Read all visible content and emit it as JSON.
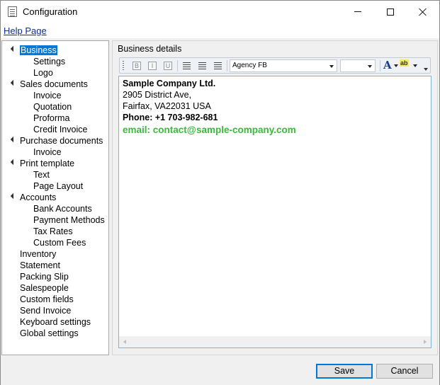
{
  "window": {
    "title": "Configuration"
  },
  "menu": {
    "help_label": "Help Page"
  },
  "tree": {
    "items": [
      {
        "label": "Business",
        "level": 0,
        "expandable": true,
        "selected": true
      },
      {
        "label": "Settings",
        "level": 1
      },
      {
        "label": "Logo",
        "level": 1
      },
      {
        "label": "Sales documents",
        "level": 0,
        "expandable": true
      },
      {
        "label": "Invoice",
        "level": 1
      },
      {
        "label": "Quotation",
        "level": 1
      },
      {
        "label": "Proforma",
        "level": 1
      },
      {
        "label": "Credit Invoice",
        "level": 1
      },
      {
        "label": "Purchase documents",
        "level": 0,
        "expandable": true
      },
      {
        "label": "Invoice",
        "level": 1
      },
      {
        "label": "Print template",
        "level": 0,
        "expandable": true
      },
      {
        "label": "Text",
        "level": 1
      },
      {
        "label": "Page Layout",
        "level": 1
      },
      {
        "label": "Accounts",
        "level": 0,
        "expandable": true
      },
      {
        "label": "Bank Accounts",
        "level": 1
      },
      {
        "label": "Payment Methods",
        "level": 1
      },
      {
        "label": "Tax Rates",
        "level": 1
      },
      {
        "label": "Custom Fees",
        "level": 1
      },
      {
        "label": "Inventory",
        "level": 0
      },
      {
        "label": "Statement",
        "level": 0
      },
      {
        "label": "Packing Slip",
        "level": 0
      },
      {
        "label": "Salespeople",
        "level": 0
      },
      {
        "label": "Custom fields",
        "level": 0
      },
      {
        "label": "Send Invoice",
        "level": 0
      },
      {
        "label": "Keyboard settings",
        "level": 0
      },
      {
        "label": "Global settings",
        "level": 0
      }
    ]
  },
  "details": {
    "group_label": "Business details",
    "toolbar": {
      "font_name": "Agency FB",
      "font_size": "",
      "font_color_glyph": "A",
      "highlight_glyph": "ab"
    },
    "editor": {
      "company": "Sample Company Ltd.",
      "address1": "2905 District Ave,",
      "address2": "Fairfax, VA22031 USA",
      "phone": "Phone: +1 703-982-681",
      "email": "email: contact@sample-company.com",
      "email_color": "#3cb83c"
    }
  },
  "buttons": {
    "save": "Save",
    "cancel": "Cancel"
  },
  "colors": {
    "selection": "#0078d7",
    "link": "#0b2e9e"
  }
}
